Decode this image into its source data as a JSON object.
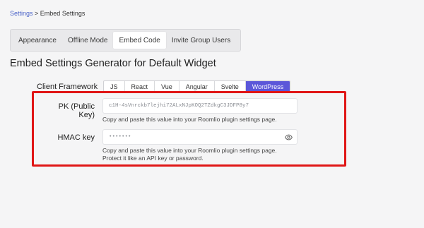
{
  "breadcrumb": {
    "link": "Settings",
    "separator": " > ",
    "current": "Embed Settings"
  },
  "tabs": [
    {
      "label": "Appearance",
      "active": false
    },
    {
      "label": "Offline Mode",
      "active": false
    },
    {
      "label": "Embed Code",
      "active": true
    },
    {
      "label": "Invite Group Users",
      "active": false
    }
  ],
  "page_title": "Embed Settings Generator for Default Widget",
  "framework": {
    "label": "Client Framework",
    "options": [
      "JS",
      "React",
      "Vue",
      "Angular",
      "Svelte",
      "WordPress"
    ],
    "selected": "WordPress"
  },
  "pk": {
    "label": "PK (Public Key)",
    "value": "c1H-4sVnrckb7lejhi72ALxNJpKOQ2TZdkgC3JDFP8y7",
    "helper": "Copy and paste this value into your Roomlio plugin settings page."
  },
  "hmac": {
    "label": "HMAC key",
    "value": "•••••••",
    "helper_line1": "Copy and paste this value into your Roomlio plugin settings page.",
    "helper_line2": "Protect it like an API key or password."
  },
  "colors": {
    "accent": "#5b57d9",
    "highlight": "#e01616",
    "link": "#4b63c8"
  }
}
